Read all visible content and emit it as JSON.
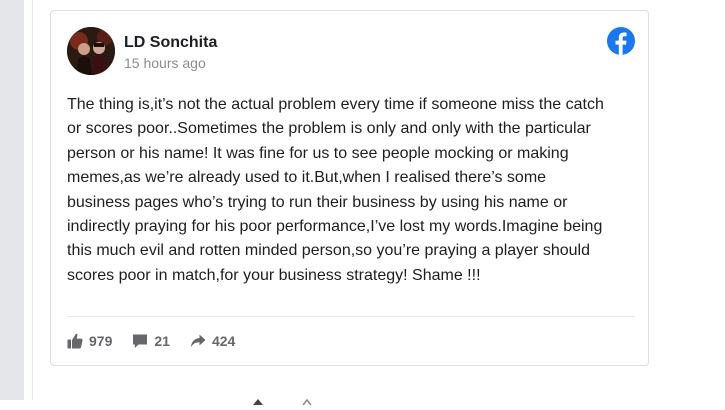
{
  "post": {
    "author": "LD Sonchita",
    "timestamp": "15 hours ago",
    "platform_icon": "facebook-icon",
    "text": "The thing is,it’s not the actual problem every time if someone miss the catch or scores poor..Sometimes the problem is only and only with the particular person or his name! It was fine for us to see people mocking or making memes,as we’re already used to it.But,when I realised there’s some business pages who’s trying to run their business by using his name or indirectly praying for his poor performance,I’ve lost my words.Imagine being this much evil and rotten minded person,so you’re praying a player should scores poor in match,for your business strategy! Shame !!!",
    "text_lines": [
      "The thing is,it’s not the actual problem every time if someone miss the catch",
      "or scores poor..Sometimes the problem is only and only with the particular",
      "person or his name! It was fine for us to see people mocking or making",
      "memes,as we’re already used to it.But,when I realised there’s some",
      "business pages who’s trying to run their business by using his name or",
      "indirectly praying for his poor performance,I’ve lost my words.Imagine being",
      "this much evil and rotten minded person,so you’re praying a player should",
      "scores poor in match,for your business strategy! Shame !!!"
    ]
  },
  "stats": {
    "likes": {
      "icon": "thumbs-up-icon",
      "value": "979"
    },
    "comments": {
      "icon": "comment-icon",
      "value": "21"
    },
    "shares": {
      "icon": "share-icon",
      "value": "424"
    }
  },
  "colors": {
    "facebook_blue": "#1877f2",
    "stat_gray": "#65676b",
    "text": "#1c1e21",
    "muted": "#8a8d91"
  }
}
